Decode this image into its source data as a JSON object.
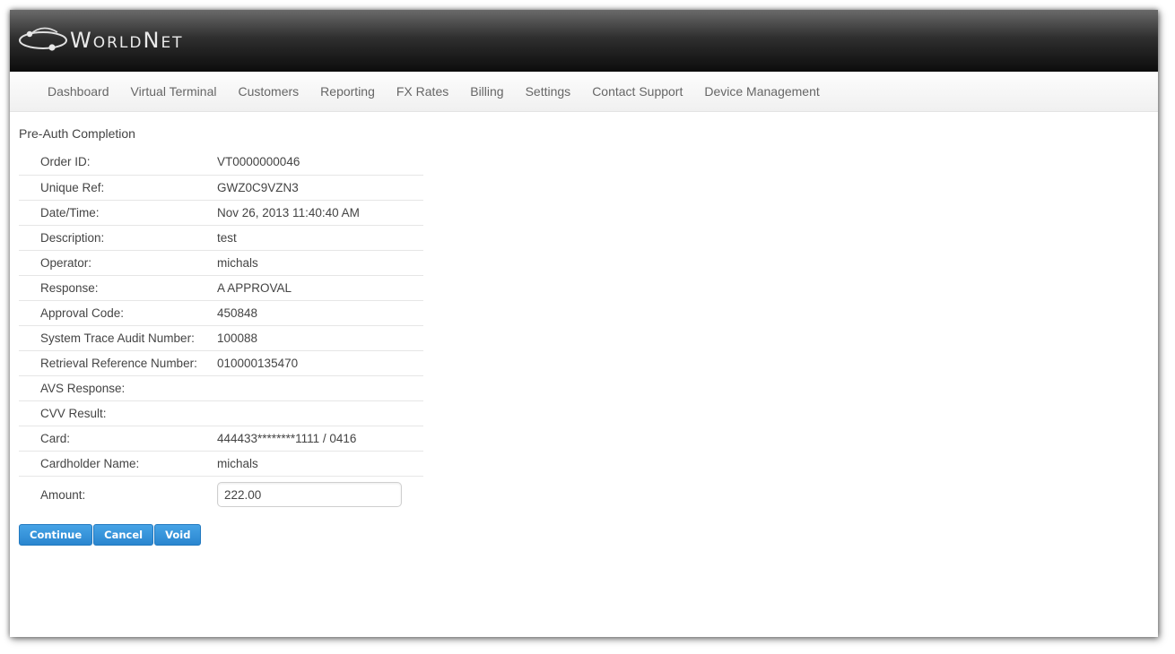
{
  "header": {
    "logo_text": "WorldNet"
  },
  "nav": {
    "items": [
      "Dashboard",
      "Virtual Terminal",
      "Customers",
      "Reporting",
      "FX Rates",
      "Billing",
      "Settings",
      "Contact Support",
      "Device Management"
    ]
  },
  "page": {
    "title": "Pre-Auth Completion"
  },
  "details": [
    {
      "label": "Order ID:",
      "value": "VT0000000046"
    },
    {
      "label": "Unique Ref:",
      "value": "GWZ0C9VZN3"
    },
    {
      "label": "Date/Time:",
      "value": "Nov 26, 2013 11:40:40 AM"
    },
    {
      "label": "Description:",
      "value": "test"
    },
    {
      "label": "Operator:",
      "value": "michals"
    },
    {
      "label": "Response:",
      "value": "A APPROVAL"
    },
    {
      "label": "Approval Code:",
      "value": "450848"
    },
    {
      "label": "System Trace Audit Number:",
      "value": "100088"
    },
    {
      "label": "Retrieval Reference Number:",
      "value": "010000135470"
    },
    {
      "label": "AVS Response:",
      "value": ""
    },
    {
      "label": "CVV Result:",
      "value": ""
    },
    {
      "label": "Card:",
      "value": "444433********1111 / 0416"
    },
    {
      "label": "Cardholder Name:",
      "value": "michals"
    }
  ],
  "amount": {
    "label": "Amount:",
    "value": "222.00"
  },
  "buttons": {
    "continue": "Continue",
    "cancel": "Cancel",
    "void": "Void"
  }
}
